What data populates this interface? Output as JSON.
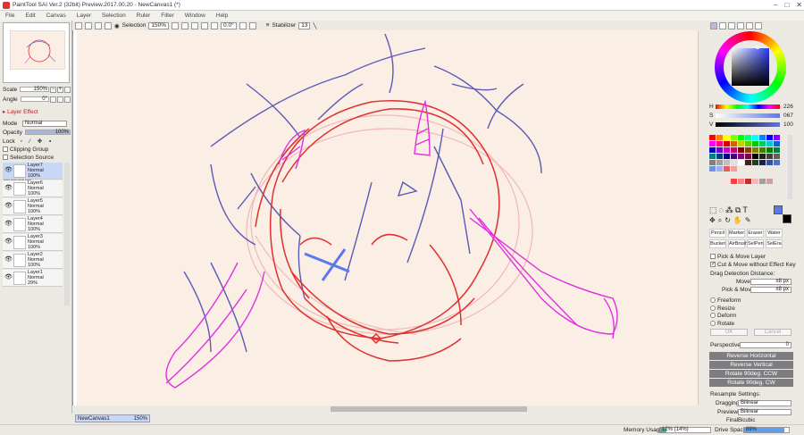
{
  "window": {
    "title": "PaintTool SAI Ver.2 (32bit) Preview.2017.00.20 - NewCanvas1 (*)"
  },
  "menu": [
    "File",
    "Edit",
    "Canvas",
    "Layer",
    "Selection",
    "Ruler",
    "Filter",
    "Window",
    "Help"
  ],
  "toolbar": {
    "selection_label": "Selection",
    "zoom": "150%",
    "angle": "0.0°",
    "stabilizer_label": "Stabilizer",
    "stabilizer_value": "13"
  },
  "left": {
    "scale_label": "Scale",
    "scale_value": "150%",
    "angle_label": "Angle",
    "angle_value": "0°",
    "layer_effect": "Layer Effect",
    "mode_label": "Mode",
    "mode_value": "Normal",
    "opacity_label": "Opacity",
    "opacity_value": "100%",
    "lock_label": "Lock",
    "clipping_group": "Clipping Group",
    "selection_source": "Selection Source",
    "layers": [
      {
        "name": "Layer7",
        "mode": "Normal",
        "opacity": "100%",
        "selected": true
      },
      {
        "name": "Layer6",
        "mode": "Normal",
        "opacity": "100%"
      },
      {
        "name": "Layer5",
        "mode": "Normal",
        "opacity": "100%"
      },
      {
        "name": "Layer4",
        "mode": "Normal",
        "opacity": "100%"
      },
      {
        "name": "Layer3",
        "mode": "Normal",
        "opacity": "100%"
      },
      {
        "name": "Layer2",
        "mode": "Normal",
        "opacity": "100%"
      },
      {
        "name": "Layer1",
        "mode": "Normal",
        "opacity": "29%"
      }
    ]
  },
  "canvas_tab": {
    "name": "NewCanvas1",
    "zoom": "150%"
  },
  "status": {
    "memory_label": "Memory Usage",
    "memory_value": "12% (14%)",
    "drive_label": "Drive Space",
    "drive_value": "89%"
  },
  "right": {
    "h_label": "H",
    "h_value": "226",
    "s_label": "S",
    "s_value": "067",
    "v_label": "V",
    "v_value": "100",
    "tool_icon": "T",
    "brushes": [
      "Pencil",
      "Marker",
      "Eraser",
      "Water",
      "Bucket",
      "AirBrush",
      "SelPen",
      "SelEra"
    ],
    "pick_move_layer": "Pick & Move Layer",
    "cut_move": "Cut & Move without Effect Key",
    "drag_detection": "Drag Detection Distance:",
    "move_label": "Move",
    "move_value": "±8 px",
    "pick_move_label": "Pick & Move",
    "pick_move_value": "±8 px",
    "transforms": [
      "Freeform",
      "Resize",
      "Deform",
      "Rotate"
    ],
    "ok": "OK",
    "cancel": "Cancel",
    "perspective_label": "Perspective",
    "perspective_value": "0",
    "buttons": [
      "Reverse Horizontal",
      "Reverse Vertical",
      "Rotate 90deg. CCW",
      "Rotate 90deg. CW"
    ],
    "resample": "Resample Settings:",
    "dragging_label": "Dragging",
    "dragging_value": "Bilinear",
    "preview_label": "Preview",
    "preview_value": "Bilinear",
    "final_label": "Final",
    "final_value": "Bicubic"
  },
  "colors": {
    "selected_layer": "#c8d7f5",
    "paper": "#fbeee4",
    "accent_red": "#e03030",
    "sketch_blue": "#5a5ab8",
    "sketch_magenta": "#e030e0",
    "current_color": "#5a78f0"
  }
}
